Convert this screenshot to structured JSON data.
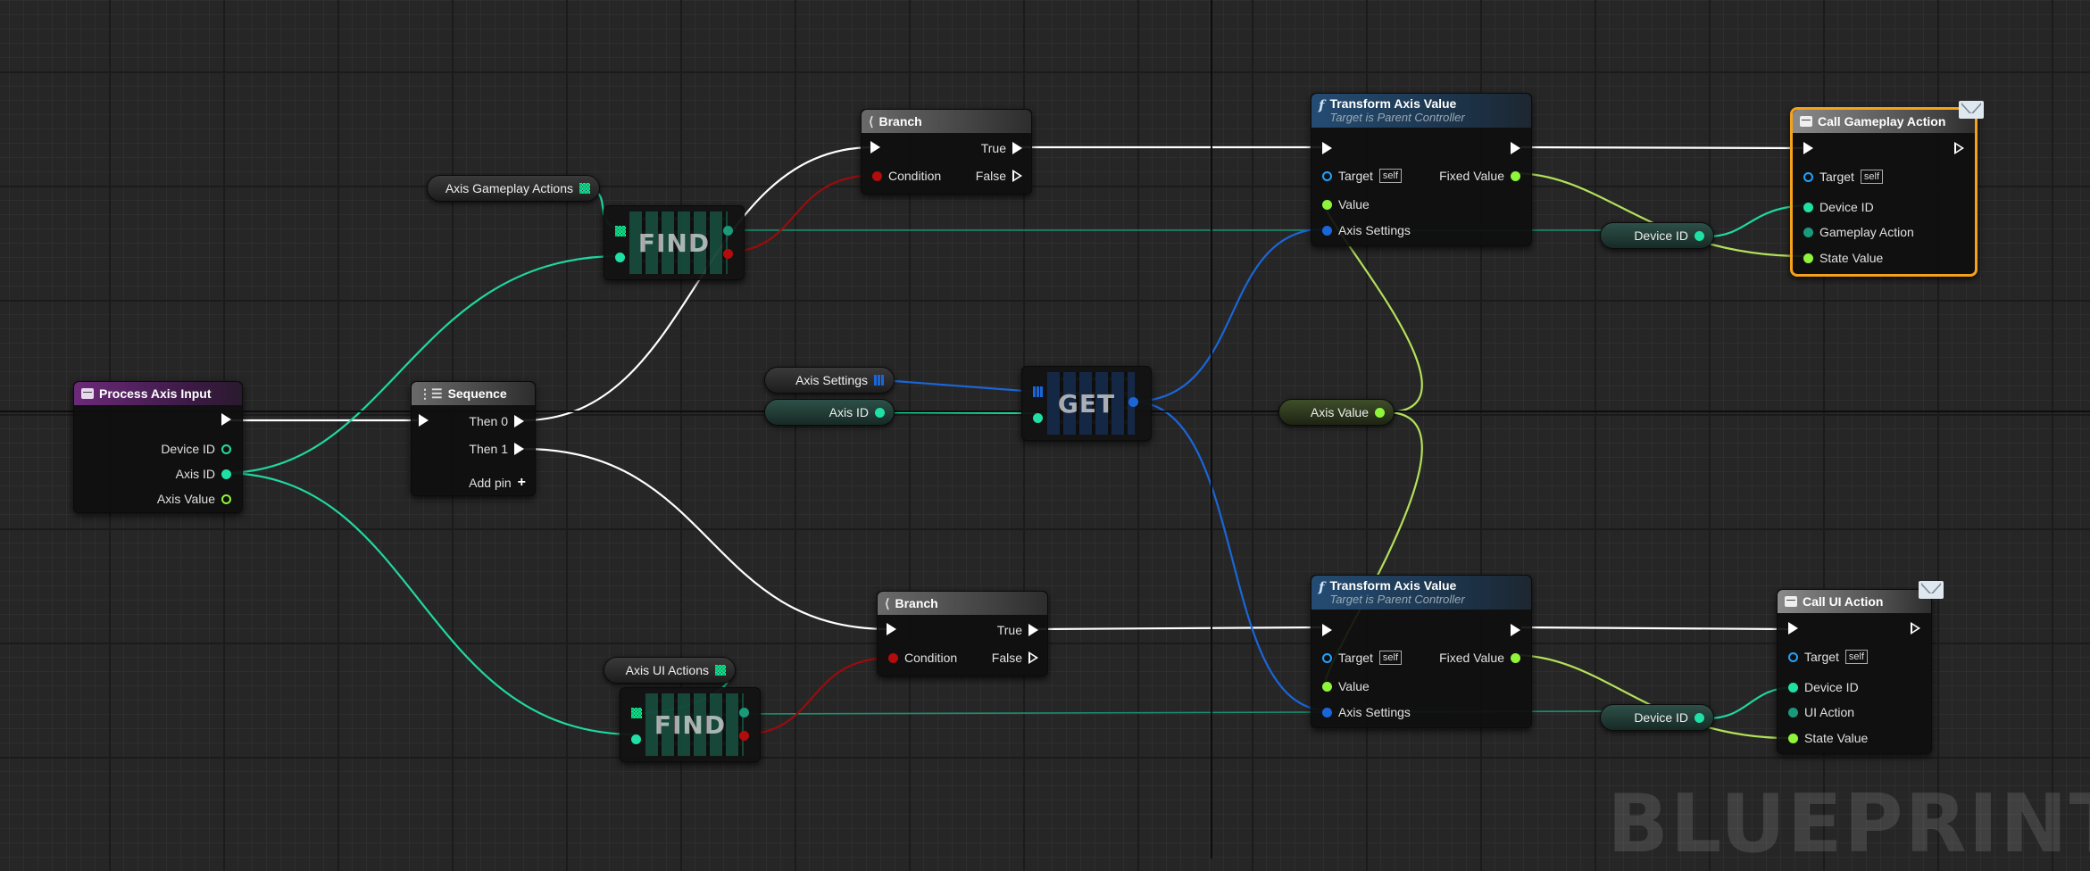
{
  "graph": {
    "watermark": "BLUEPRINT",
    "colors": {
      "exec": "#ffffff",
      "int": "#1fe0a5",
      "float": "#8ff53a",
      "bool": "#b30c0c",
      "struct": "#1a66d9",
      "selection": "#f5a11a"
    }
  },
  "event_node": {
    "title": "Process Axis Input",
    "pins": {
      "device_id": "Device ID",
      "axis_id": "Axis ID",
      "axis_value": "Axis Value"
    }
  },
  "sequence_node": {
    "title": "Sequence",
    "then0": "Then 0",
    "then1": "Then 1",
    "add_pin": "Add pin"
  },
  "branch_top": {
    "title": "Branch",
    "condition": "Condition",
    "true": "True",
    "false": "False"
  },
  "branch_bottom": {
    "title": "Branch",
    "condition": "Condition",
    "true": "True",
    "false": "False"
  },
  "find_top": {
    "label": "FIND"
  },
  "find_bottom": {
    "label": "FIND"
  },
  "get_node": {
    "label": "GET"
  },
  "var_axis_gameplay_actions": "Axis Gameplay Actions",
  "var_axis_ui_actions": "Axis UI Actions",
  "var_axis_settings": "Axis Settings",
  "var_axis_id": "Axis ID",
  "var_axis_value": "Axis Value",
  "var_device_id_top": "Device ID",
  "var_device_id_bottom": "Device ID",
  "transform_top": {
    "title": "Transform Axis Value",
    "subtitle": "Target is Parent Controller",
    "target": "Target",
    "self": "self",
    "value": "Value",
    "axis_settings": "Axis Settings",
    "fixed_value": "Fixed Value"
  },
  "transform_bottom": {
    "title": "Transform Axis Value",
    "subtitle": "Target is Parent Controller",
    "target": "Target",
    "self": "self",
    "value": "Value",
    "axis_settings": "Axis Settings",
    "fixed_value": "Fixed Value"
  },
  "call_gameplay": {
    "title": "Call Gameplay Action",
    "target": "Target",
    "self": "self",
    "device_id": "Device ID",
    "action": "Gameplay Action",
    "state_value": "State Value"
  },
  "call_ui": {
    "title": "Call UI Action",
    "target": "Target",
    "self": "self",
    "device_id": "Device ID",
    "action": "UI Action",
    "state_value": "State Value"
  }
}
